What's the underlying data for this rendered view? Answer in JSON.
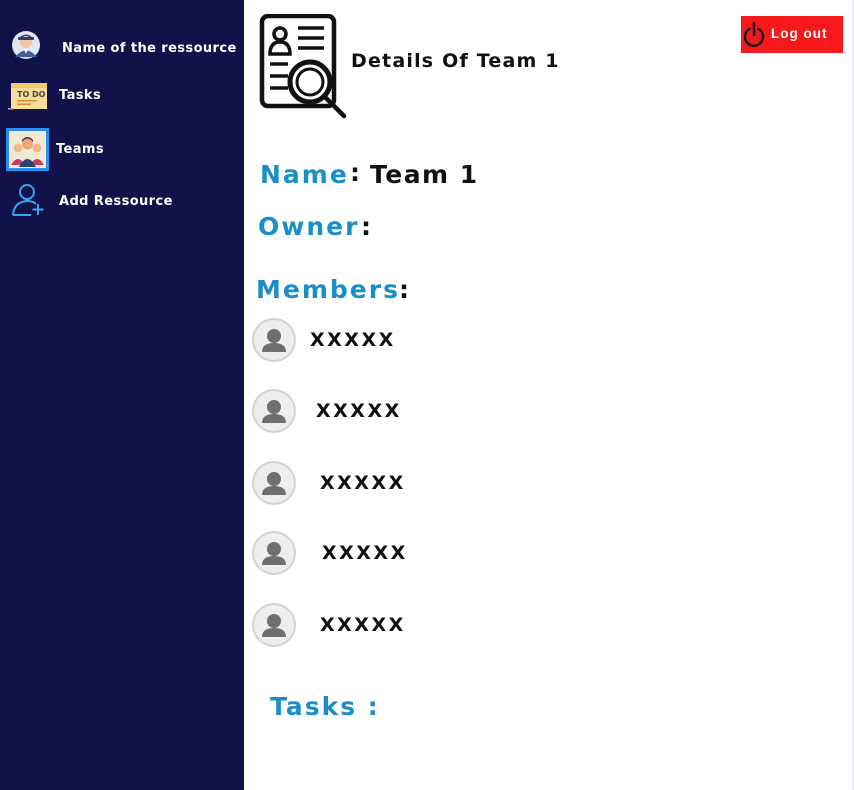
{
  "sidebar": {
    "items": [
      {
        "label": "Name of the ressource",
        "icon": "user-avatar-icon"
      },
      {
        "label": "Tasks",
        "icon": "todo-note-icon"
      },
      {
        "label": "Teams",
        "icon": "team-icon",
        "active": true
      },
      {
        "label": "Add Ressource",
        "icon": "add-user-icon"
      }
    ],
    "background": "#12124a",
    "active_border": "#2b8ff0"
  },
  "header": {
    "title": "Details Of Team 1",
    "icon": "document-search-icon",
    "logout_label": "Log out",
    "logout_color": "#f5191b"
  },
  "details": {
    "name_label": "Name",
    "name_value": "Team 1",
    "owner_label": "Owner",
    "owner_value": "",
    "members_label": "Members",
    "tasks_label": "Tasks :",
    "accent": "#1a8ec7"
  },
  "members": [
    "XXXXX",
    "XXXXX",
    "XXXXX",
    "XXXXX",
    "XXXXX"
  ]
}
